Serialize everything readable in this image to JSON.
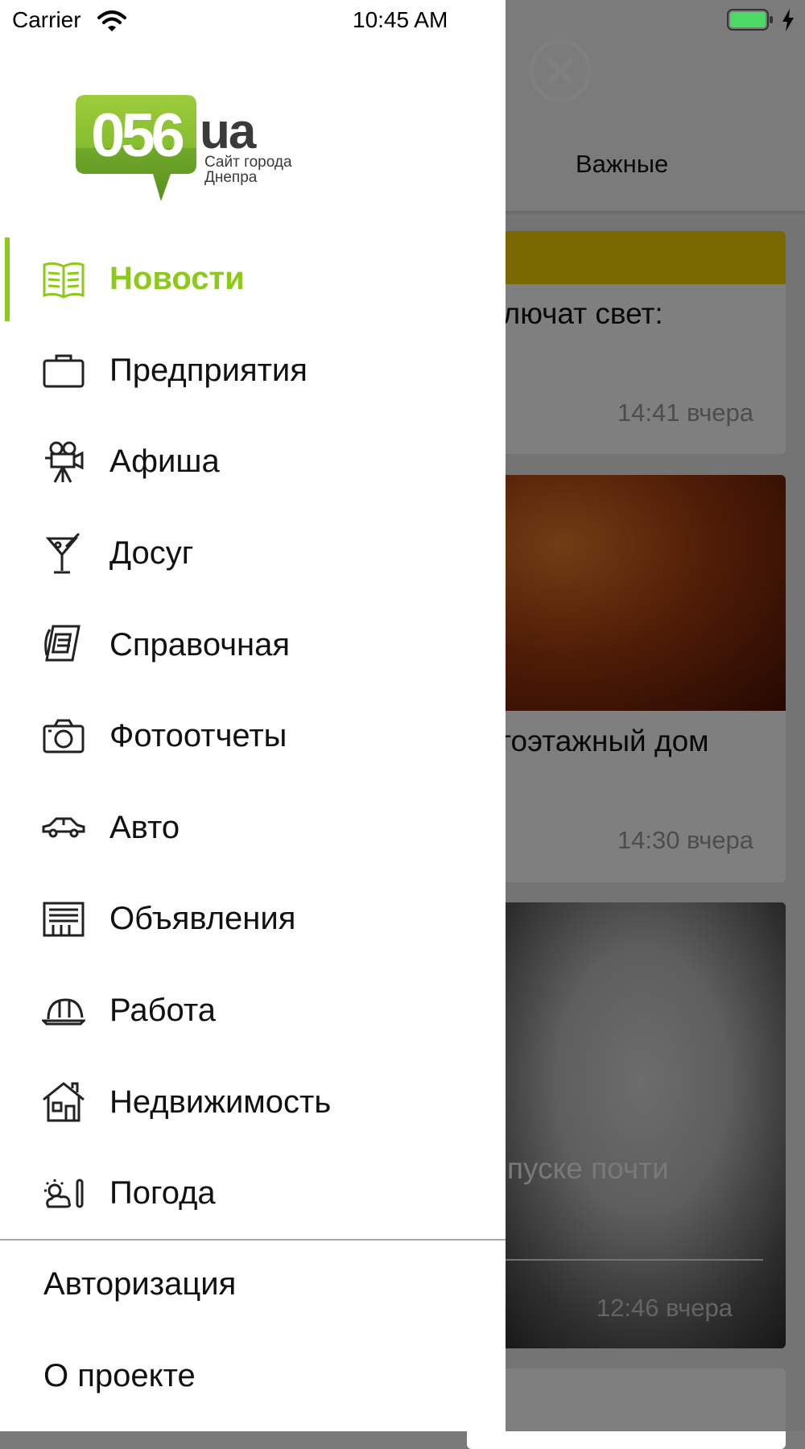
{
  "status_bar": {
    "carrier": "Carrier",
    "time": "10:45 AM"
  },
  "logo": {
    "number": "056",
    "suffix": "ua",
    "tagline_line1": "Сайт города",
    "tagline_line2": "Днепра"
  },
  "menu": {
    "items": [
      {
        "label": "Новости",
        "icon": "newspaper-icon",
        "active": true
      },
      {
        "label": "Предприятия",
        "icon": "briefcase-icon"
      },
      {
        "label": "Афиша",
        "icon": "movie-camera-icon"
      },
      {
        "label": "Досуг",
        "icon": "cocktail-icon"
      },
      {
        "label": "Справочная",
        "icon": "phone-icon"
      },
      {
        "label": "Фотоотчеты",
        "icon": "camera-icon"
      },
      {
        "label": "Авто",
        "icon": "car-icon"
      },
      {
        "label": "Объявления",
        "icon": "classifieds-icon"
      },
      {
        "label": "Работа",
        "icon": "hard-hat-icon"
      },
      {
        "label": "Недвижимость",
        "icon": "house-icon"
      },
      {
        "label": "Погода",
        "icon": "weather-icon"
      }
    ],
    "auth": "Авторизация",
    "about": "О проекте"
  },
  "background": {
    "tab": "Важные",
    "cards": [
      {
        "title": "ключат свет:",
        "time": "14:41 вчера"
      },
      {
        "title": "тоэтажный дом",
        "time": "14:30 вчера"
      },
      {
        "title": "пуске почти",
        "time": "12:46 вчера"
      }
    ]
  },
  "colors": {
    "accent": "#8cc919",
    "logo_green": "#6fa92a"
  }
}
